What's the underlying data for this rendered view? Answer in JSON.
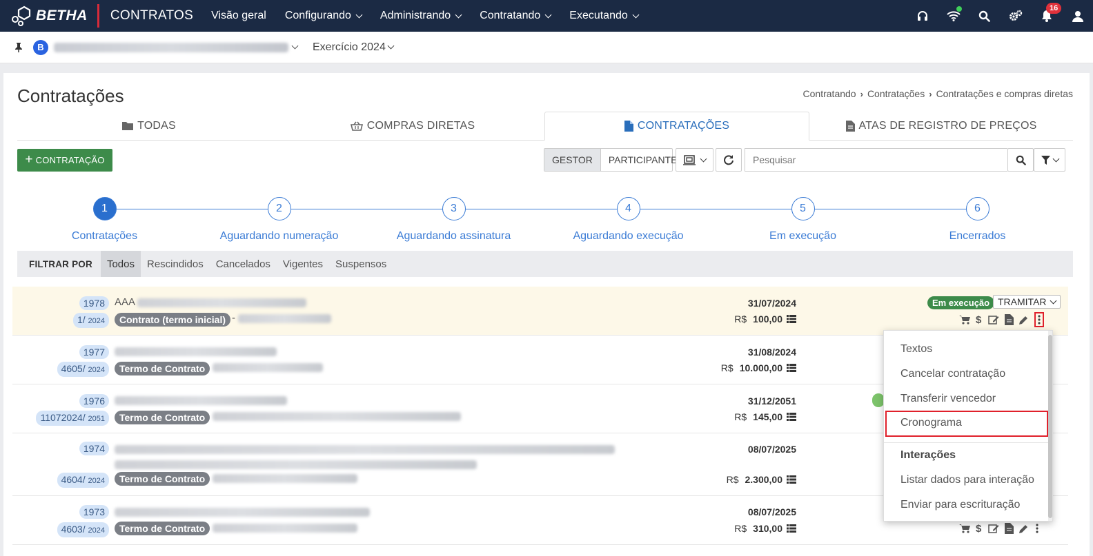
{
  "topbar": {
    "brand": "BETHA",
    "app_name": "CONTRATOS",
    "nav": [
      "Visão geral",
      "Configurando",
      "Administrando",
      "Contratando",
      "Executando"
    ],
    "notifications_count": "16",
    "icons": [
      "headset-icon",
      "wifi-icon",
      "search-icon",
      "gears-icon",
      "bell-icon",
      "user-icon"
    ]
  },
  "subbar": {
    "entity_initial": "B",
    "exercise": "Exercício 2024"
  },
  "page": {
    "title": "Contratações",
    "breadcrumb": [
      "Contratando",
      "Contratações",
      "Contratações e compras diretas"
    ]
  },
  "tabs": [
    {
      "label": "TODAS",
      "icon": "folder-icon"
    },
    {
      "label": "COMPRAS DIRETAS",
      "icon": "basket-icon"
    },
    {
      "label": "CONTRATAÇÕES",
      "icon": "file-icon",
      "active": true
    },
    {
      "label": "ATAS DE REGISTRO DE PREÇOS",
      "icon": "file-text-icon"
    }
  ],
  "toolbar": {
    "new_button": "CONTRATAÇÃO",
    "toggle_gestor": "GESTOR",
    "toggle_participante": "PARTICIPANTE",
    "search_placeholder": "Pesquisar"
  },
  "steps": [
    {
      "n": "1",
      "label": "Contratações",
      "active": true
    },
    {
      "n": "2",
      "label": "Aguardando numeração"
    },
    {
      "n": "3",
      "label": "Aguardando assinatura"
    },
    {
      "n": "4",
      "label": "Aguardando execução"
    },
    {
      "n": "5",
      "label": "Em execução"
    },
    {
      "n": "6",
      "label": "Encerrados"
    }
  ],
  "filter": {
    "label": "FILTRAR POR",
    "options": [
      "Todos",
      "Rescindidos",
      "Cancelados",
      "Vigentes",
      "Suspensos"
    ],
    "selected": "Todos"
  },
  "rows": [
    {
      "seq": "1978",
      "num": "1/",
      "year": "2024",
      "prefix": "AAA",
      "kind": "Contrato (termo inicial)",
      "separator": "-",
      "date": "31/07/2024",
      "currency": "R$",
      "value": "100,00",
      "status": "Em execução",
      "tramitar": "TRAMITAR"
    },
    {
      "seq": "1977",
      "num": "4605/",
      "year": "2024",
      "kind": "Termo de Contrato",
      "date": "31/08/2024",
      "currency": "R$",
      "value": "10.000,00"
    },
    {
      "seq": "1976",
      "num": "11072024/",
      "year": "2051",
      "kind": "Termo de Contrato",
      "date": "31/12/2051",
      "currency": "R$",
      "value": "145,00"
    },
    {
      "seq": "1974",
      "num": "4604/",
      "year": "2024",
      "kind": "Termo de Contrato",
      "date": "08/07/2025",
      "currency": "R$",
      "value": "2.300,00"
    },
    {
      "seq": "1973",
      "num": "4603/",
      "year": "2024",
      "kind": "Termo de Contrato",
      "date": "08/07/2025",
      "currency": "R$",
      "value": "310,00"
    }
  ],
  "menu": {
    "items": [
      "Textos",
      "Cancelar contratação",
      "Transferir vencedor",
      "Cronograma"
    ],
    "section": "Interações",
    "section_items": [
      "Listar dados para interação",
      "Enviar para escrituração"
    ],
    "highlighted": "Cronograma"
  },
  "colors": {
    "topbar": "#1b2a44",
    "accent": "#3a7bd5",
    "success": "#3d8b4a",
    "highlight": "#e0202b"
  }
}
